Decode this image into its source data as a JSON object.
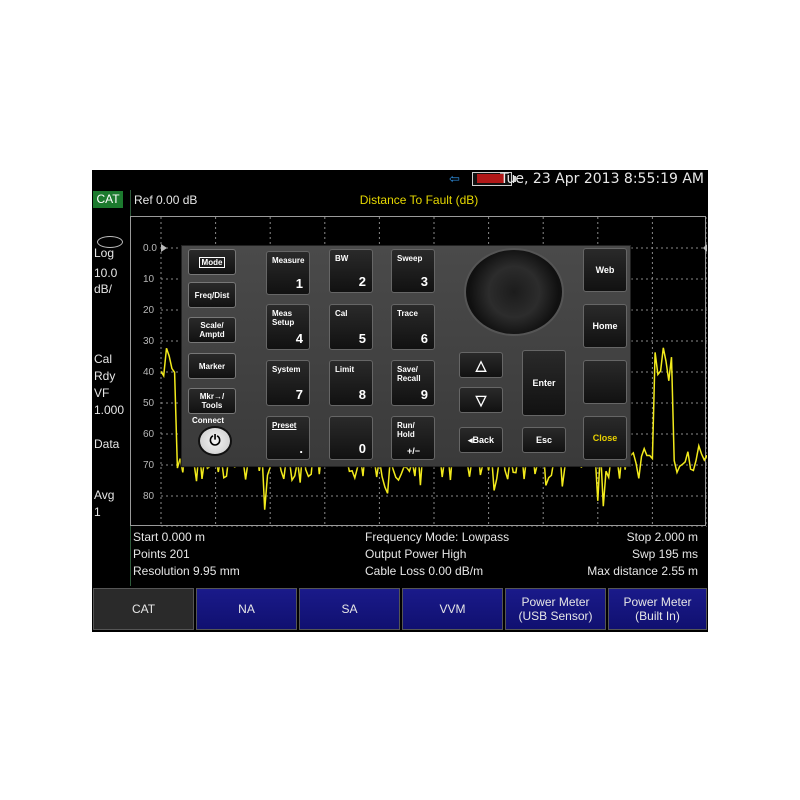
{
  "status": {
    "datetime": "Tue, 23 Apr 2013 8:55:19 AM"
  },
  "left_panel": {
    "mode": "CAT",
    "scale_type": "Log",
    "scale_value": "10.0",
    "scale_unit": "dB/",
    "cal": "Cal",
    "cal_status": "Rdy",
    "vf_label": "VF",
    "vf_value": "1.000",
    "data_label": "Data",
    "avg_label": "Avg",
    "avg_value": "1"
  },
  "header": {
    "ref": "Ref 0.00 dB",
    "title": "Distance To Fault (dB)"
  },
  "plot": {
    "y_ticks": [
      "0.0",
      "10",
      "20",
      "30",
      "40",
      "50",
      "60",
      "70",
      "80"
    ],
    "trace_color": "#f2ea1c",
    "grid_color": "#8a8a8a"
  },
  "chart_data": {
    "type": "line",
    "title": "Distance To Fault (dB)",
    "ylim": [
      0,
      90
    ],
    "y_inverted": true,
    "x_range_m": [
      0.0,
      2.0
    ],
    "grid": true
  },
  "info": {
    "start": "Start 0.000 m",
    "points": "Points 201",
    "resolution": "Resolution 9.95 mm",
    "freq_mode": "Frequency Mode: Lowpass",
    "output_power": "Output Power High",
    "cable_loss": "Cable Loss 0.00  dB/m",
    "stop": "Stop 2.000 m",
    "sweep": "Swp 195 ms",
    "max_distance": "Max distance 2.55  m"
  },
  "softkeys": [
    {
      "label": "CAT"
    },
    {
      "label": "NA"
    },
    {
      "label": "SA"
    },
    {
      "label": "VVM"
    },
    {
      "label1": "Power Meter",
      "label2": "(USB Sensor)"
    },
    {
      "label1": "Power Meter",
      "label2": "(Built In)"
    }
  ],
  "keypad": {
    "mode": "Mode",
    "freq_dist": "Freq/Dist",
    "scale_amptd_1": "Scale/",
    "scale_amptd_2": "Amptd",
    "marker": "Marker",
    "mkr_tools_1": "Mkr→/",
    "mkr_tools_2": "Tools",
    "connect": "Connect",
    "measure": "Measure",
    "measure_n": "1",
    "bw": "BW",
    "bw_n": "2",
    "sweep": "Sweep",
    "sweep_n": "3",
    "meas_setup_1": "Meas",
    "meas_setup_2": "Setup",
    "meas_setup_n": "4",
    "cal": "Cal",
    "cal_n": "5",
    "trace": "Trace",
    "trace_n": "6",
    "system": "System",
    "system_n": "7",
    "limit": "Limit",
    "limit_n": "8",
    "save_recall_1": "Save/",
    "save_recall_2": "Recall",
    "save_recall_n": "9",
    "preset": "Preset",
    "preset_n": ".",
    "zero_n": "0",
    "run_hold_1": "Run/",
    "run_hold_2": "Hold",
    "run_hold_n": "+/−",
    "back": "◂Back",
    "esc": "Esc",
    "enter": "Enter",
    "web": "Web",
    "home": "Home",
    "close": "Close",
    "close_color": "#e8d000"
  }
}
